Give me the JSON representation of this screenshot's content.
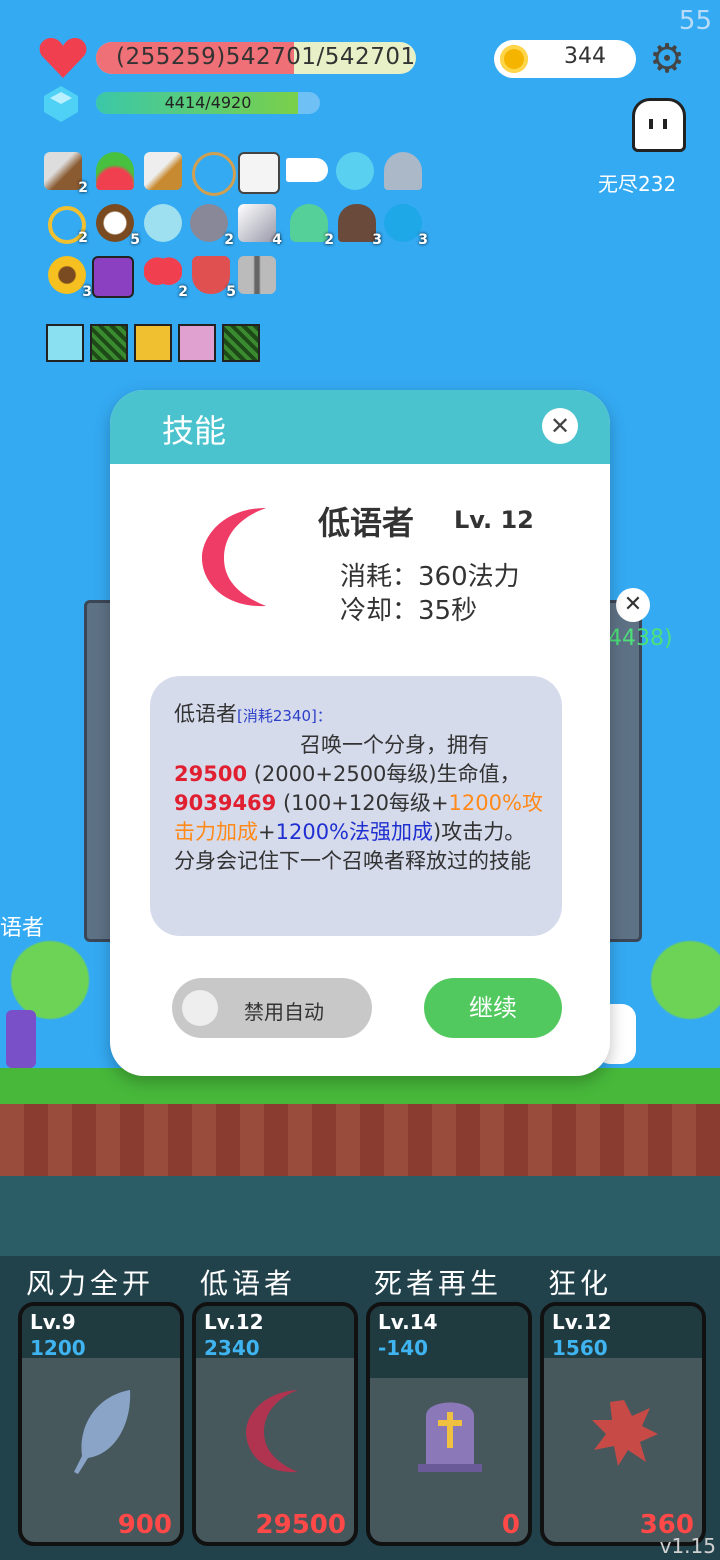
{
  "fps": "55",
  "version": "v1.15",
  "hud": {
    "hp_text": "(255259)542701/542701",
    "hp_fraction": 1.0,
    "mp_text": "4414/4920",
    "mp_fraction": 0.897,
    "coins": "344",
    "endless_label": "无尽232"
  },
  "inventory_counts": [
    "2",
    "",
    "",
    "",
    "",
    "",
    "",
    "",
    "2",
    "5",
    "",
    "2",
    "4",
    "2",
    "3",
    "3",
    "3",
    "",
    "2",
    "5",
    ""
  ],
  "background_panel": {
    "partial_value": "4438)",
    "side_label": "语者"
  },
  "dialog": {
    "title": "技能",
    "skill_name": "低语者",
    "skill_level": "Lv. 12",
    "cost": "消耗：360法力",
    "cooldown": "冷却：35秒",
    "desc_head": "低语者",
    "desc_tag": "[消耗2340]：",
    "desc_line1": "召唤一个分身，拥有",
    "hp_value": "29500",
    "hp_formula": " (2000+2500每级)生命值，",
    "atk_value": "9039469",
    "atk_formula": " (100+120每级",
    "plus1": "+",
    "atk_bonus": "1200%攻击力加成",
    "plus2": "+",
    "spell_bonus": "1200%法强加成",
    "desc_tail": ")攻击力。分身会记住下一个召唤者释放过的技能",
    "toggle_label": "禁用自动",
    "continue_label": "继续"
  },
  "skills": [
    {
      "name": "风力全开",
      "level": "Lv.9",
      "cost": "1200",
      "value": "900",
      "icon": "feather-icon"
    },
    {
      "name": "低语者",
      "level": "Lv.12",
      "cost": "2340",
      "value": "29500",
      "icon": "moon-icon"
    },
    {
      "name": "死者再生",
      "level": "Lv.14",
      "cost": "-140",
      "value": "0",
      "icon": "tombstone-icon"
    },
    {
      "name": "狂化",
      "level": "Lv.12",
      "cost": "1560",
      "value": "360",
      "icon": "rage-splat-icon"
    }
  ]
}
